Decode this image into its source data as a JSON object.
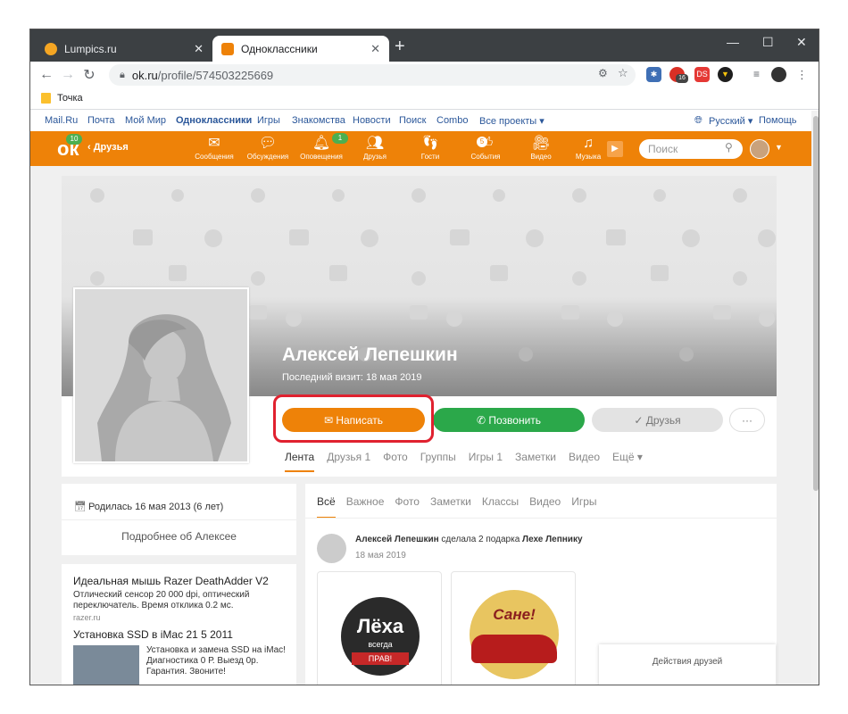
{
  "browser": {
    "tabs": [
      {
        "title": "Lumpics.ru",
        "close": "✕"
      },
      {
        "title": "Одноклассники",
        "close": "✕"
      }
    ],
    "new_tab": "+",
    "window_controls": [
      "—",
      "☐",
      "✕"
    ],
    "url_host": "ok.ru",
    "url_path": "/profile/574503225669",
    "extension_badges": {
      "badge16": "16",
      "ds": "DS"
    },
    "bookmark": "Точка"
  },
  "portal": {
    "links": [
      "Mail.Ru",
      "Почта",
      "Мой Мир",
      "Одноклассники",
      "Игры",
      "Знакомства",
      "Новости",
      "Поиск",
      "Combo",
      "Все проекты ▾"
    ],
    "language": "Русский ▾",
    "help": "Помощь"
  },
  "header": {
    "ok_badge": "10",
    "back_label": "‹  Друзья",
    "nav": [
      {
        "label": "Сообщения",
        "icon": "envelope-icon"
      },
      {
        "label": "Обсуждения",
        "icon": "chat-icon"
      },
      {
        "label": "Оповещения",
        "icon": "bell-icon",
        "badge": "1"
      },
      {
        "label": "Друзья",
        "icon": "friends-icon"
      },
      {
        "label": "Гости",
        "icon": "footprints-icon"
      },
      {
        "label": "События",
        "icon": "events-icon",
        "badge": "5"
      },
      {
        "label": "Видео",
        "icon": "video-icon"
      },
      {
        "label": "Музыка",
        "icon": "music-icon"
      }
    ],
    "search_placeholder": "Поиск"
  },
  "profile": {
    "name": "Алексей Лепешкин",
    "last_visit": "Последний визит: 18 мая 2019",
    "buttons": {
      "write": "✉  Написать",
      "call": "✆  Позвонить",
      "friends": "✓  Друзья",
      "more": "···"
    },
    "tabs": [
      "Лента",
      "Друзья 1",
      "Фото",
      "Группы",
      "Игры 1",
      "Заметки",
      "Видео",
      "Ещё ▾"
    ]
  },
  "left": {
    "birthday": "Родилась 16 мая 2013 (6 лет)",
    "more_about": "Подробнее об Алексее",
    "ads": [
      {
        "title": "Идеальная мышь Razer DeathAdder V2",
        "text1": "Отлический сенсор 20 000 dpi, оптический",
        "text2": "переключатель. Время отклика 0.2 мс.",
        "source": "razer.ru"
      },
      {
        "title": "Установка SSD в iMac 21 5 2011",
        "text1": "Установка и замена SSD на iMac!",
        "text2": "Диагностика 0 Р. Выезд 0р.",
        "text3": "Гарантия. Звоните!"
      }
    ]
  },
  "feed": {
    "tabs": [
      "Всё",
      "Важное",
      "Фото",
      "Заметки",
      "Классы",
      "Видео",
      "Игры"
    ],
    "post_author": "Алексей Лепешкин",
    "post_action": " сделала 2 подарка ",
    "post_target": "Лехе Лепнику",
    "post_date": "18 мая 2019",
    "gift1_text": "Лёха",
    "gift1_sub": "всегда",
    "gift1_ribbon": "ПРАВ!",
    "gift2_text": "Сане!",
    "friends_actions": "Действия друзей"
  }
}
